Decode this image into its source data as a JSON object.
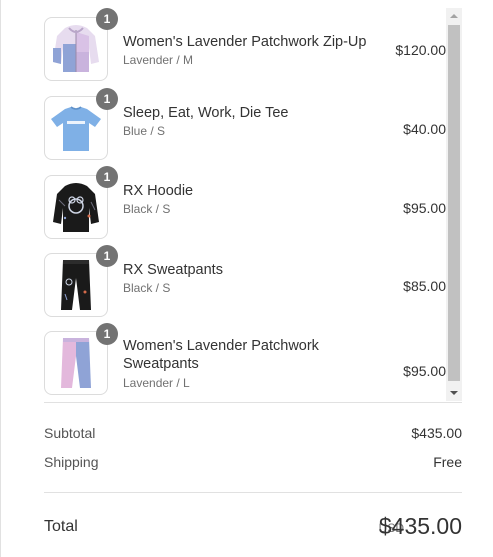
{
  "items": [
    {
      "name": "Women's Lavender Patchwork Zip-Up",
      "variant": "Lavender / M",
      "price": "$120.00",
      "quantity": "1",
      "icon": "lavender-zip-hoodie-image"
    },
    {
      "name": "Sleep, Eat, Work, Die Tee",
      "variant": "Blue / S",
      "price": "$40.00",
      "quantity": "1",
      "icon": "blue-tee-image"
    },
    {
      "name": "RX Hoodie",
      "variant": "Black / S",
      "price": "$95.00",
      "quantity": "1",
      "icon": "black-hoodie-image"
    },
    {
      "name": "RX Sweatpants",
      "variant": "Black / S",
      "price": "$85.00",
      "quantity": "1",
      "icon": "black-sweatpants-image"
    },
    {
      "name": "Women's Lavender Patchwork Sweatpants",
      "variant": "Lavender / L",
      "price": "$95.00",
      "quantity": "1",
      "icon": "lavender-sweatpants-image"
    }
  ],
  "summary": {
    "subtotal_label": "Subtotal",
    "subtotal_value": "$435.00",
    "shipping_label": "Shipping",
    "shipping_value": "Free"
  },
  "total": {
    "label": "Total",
    "currency": "USD",
    "value": "$435.00"
  },
  "colors": {
    "badge": "#737373",
    "border": "#dcdcdc",
    "text": "#333333",
    "muted": "#717171",
    "lavender": "#d9c2e6",
    "periwinkle": "#8fa3d6",
    "tee_blue": "#7fb0e6",
    "black_garment": "#1a1a1a"
  }
}
